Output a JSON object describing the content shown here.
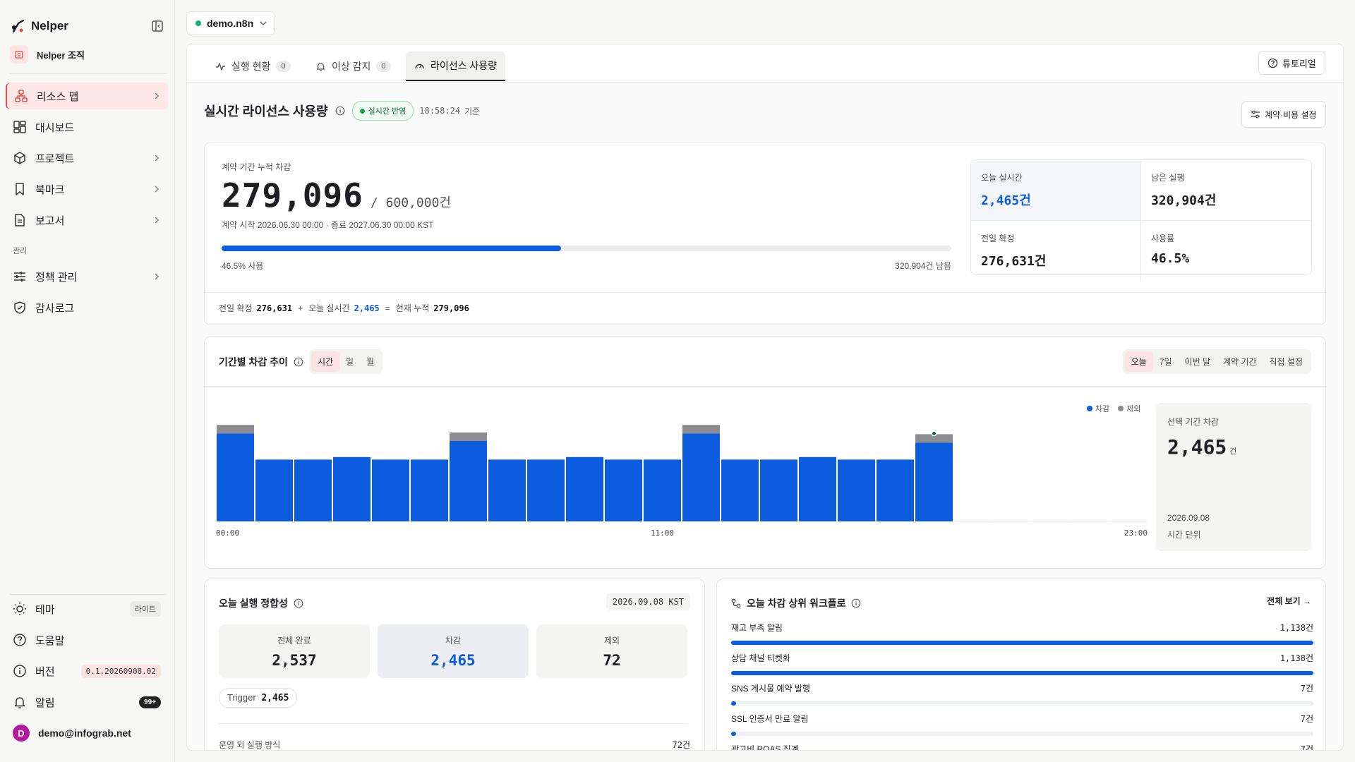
{
  "sidebar": {
    "brand": "Nelper",
    "org": "Nelper 조직",
    "nav": [
      {
        "label": "리소스 맵"
      },
      {
        "label": "대시보드"
      },
      {
        "label": "프로젝트"
      },
      {
        "label": "북마크"
      },
      {
        "label": "보고서"
      }
    ],
    "section_admin": "관리",
    "admin_nav": [
      {
        "label": "정책 관리"
      },
      {
        "label": "감사로그"
      }
    ],
    "theme_label": "테마",
    "theme_value": "라이트",
    "help_label": "도움말",
    "version_label": "버전",
    "version_value": "0.1.20260908.02",
    "alerts_label": "알림",
    "alerts_count": "99+",
    "user_initial": "D",
    "user_email": "demo@infograb.net"
  },
  "workspace": "demo.n8n",
  "tabs": [
    {
      "label": "실행 현황",
      "count": "0"
    },
    {
      "label": "이상 감지",
      "count": "0"
    },
    {
      "label": "라이선스 사용량",
      "count": ""
    }
  ],
  "tutorial_button": "튜토리얼",
  "page": {
    "title": "실시간 라이선스 사용량",
    "live_badge": "실시간 반영",
    "timestamp": "18:58:24",
    "timestamp_suffix": "기준",
    "settings_button": "계약·비용 설정"
  },
  "usage": {
    "label": "계약 기간 누적 차감",
    "current": "279,096",
    "total": "/ 600,000건",
    "period": "계약 시작 2026.06.30 00:00 · 종료 2027.06.30 00:00 KST",
    "progress_pct": 46.5,
    "used_text": "46.5% 사용",
    "remaining_text": "320,904건 남음",
    "stats": [
      {
        "label": "오늘 실시간",
        "value": "2,465건",
        "color": "#0b5cdf"
      },
      {
        "label": "남은 실행",
        "value": "320,904건",
        "color": "#1f1f23"
      },
      {
        "label": "전일 확정",
        "value": "276,631건",
        "color": "#1f1f23"
      },
      {
        "label": "사용률",
        "value": "46.5%",
        "color": "#1f1f23"
      }
    ],
    "formula": {
      "a_label": "전일 확정",
      "a_value": "276,631",
      "plus": "+",
      "b_label": "오늘 실시간",
      "b_value": "2,465",
      "eq": "=",
      "c_label": "현재 누적",
      "c_value": "279,096"
    }
  },
  "trend": {
    "title": "기간별 차감 추이",
    "granularity": [
      "시간",
      "일",
      "월"
    ],
    "granularity_selected": 0,
    "ranges": [
      "오늘",
      "7일",
      "이번 달",
      "계약 기간",
      "직접 설정"
    ],
    "range_selected": 0,
    "legend_deducted": "차감",
    "legend_excluded": "제외",
    "selected_label": "선택 기간 차감",
    "selected_value": "2,465",
    "selected_unit": "건",
    "selected_date": "2026.09.08",
    "selected_unit_label": "시간 단위"
  },
  "chart_data": {
    "type": "bar",
    "stacked": true,
    "categories": [
      "00:00",
      "01:00",
      "02:00",
      "03:00",
      "04:00",
      "05:00",
      "06:00",
      "07:00",
      "08:00",
      "09:00",
      "10:00",
      "11:00",
      "12:00",
      "13:00",
      "14:00",
      "15:00",
      "16:00",
      "17:00",
      "18:00",
      "19:00",
      "20:00",
      "21:00",
      "22:00",
      "23:00"
    ],
    "series": [
      {
        "name": "차감",
        "color": "#0b5cdf",
        "values": [
          104,
          73,
          73,
          76,
          73,
          73,
          95,
          73,
          73,
          76,
          73,
          73,
          104,
          73,
          73,
          76,
          73,
          73,
          93,
          0,
          0,
          0,
          0,
          0
        ]
      },
      {
        "name": "제외",
        "color": "#8c8c92",
        "values": [
          10,
          0,
          0,
          0,
          0,
          0,
          10,
          0,
          0,
          0,
          0,
          0,
          10,
          0,
          0,
          0,
          0,
          0,
          10,
          0,
          0,
          0,
          0,
          0
        ]
      }
    ],
    "tick_labels": [
      "00:00",
      "11:00",
      "23:00"
    ],
    "ylim": [
      0,
      125
    ],
    "grid": false,
    "legend_position": "top-right"
  },
  "integrity": {
    "title": "오늘 실행 정합성",
    "date": "2026.09.08 KST",
    "boxes": [
      {
        "label": "전체 완료",
        "value": "2,537",
        "color": "#1f1f23"
      },
      {
        "label": "차감",
        "value": "2,465",
        "color": "#0b5cdf"
      },
      {
        "label": "제외",
        "value": "72",
        "color": "#1f1f23"
      }
    ],
    "trigger_label": "Trigger",
    "trigger_value": "2,465",
    "footer_label": "운영 외 실행 방식",
    "footer_value": "72건"
  },
  "top_workflows": {
    "title": "오늘 차감 상위 워크플로",
    "view_all": "전체 보기 →",
    "rows": [
      {
        "name": "재고 부족 알림",
        "value": "1,138건",
        "share": 1138
      },
      {
        "name": "상담 채널 티켓화",
        "value": "1,138건",
        "share": 1138
      },
      {
        "name": "SNS 게시물 예약 발행",
        "value": "7건",
        "share": 7
      },
      {
        "name": "SSL 인증서 만료 알림",
        "value": "7건",
        "share": 7
      },
      {
        "name": "광고비 ROAS 집계",
        "value": "7건",
        "share": 7
      }
    ]
  }
}
